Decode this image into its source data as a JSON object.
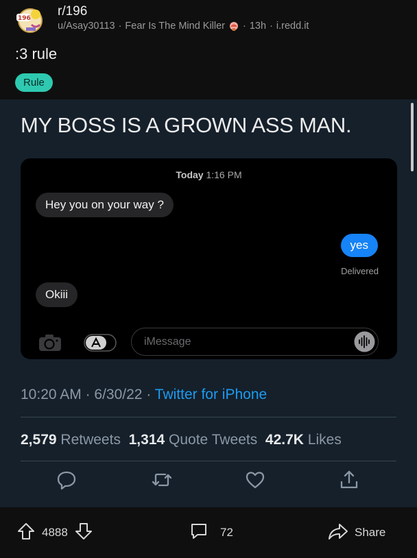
{
  "post": {
    "subreddit": "r/196",
    "username": "u/Asay30113",
    "flair": "Fear Is The Mind Killer",
    "age": "13h",
    "domain": "i.redd.it",
    "title": ":3 rule",
    "tag": "Rule"
  },
  "tweet": {
    "text": "MY BOSS IS A GROWN ASS MAN.",
    "imessage": {
      "timestamp_day": "Today",
      "timestamp_time": "1:16 PM",
      "messages": [
        {
          "from": "them",
          "text": "Hey you on your way ?"
        },
        {
          "from": "me",
          "text": "yes"
        },
        {
          "from": "them",
          "text": "Okiii"
        }
      ],
      "status": "Delivered",
      "input_placeholder": "iMessage"
    },
    "time": "10:20 AM",
    "date": "6/30/22",
    "source": "Twitter for iPhone",
    "retweets": "2,579",
    "retweets_label": "Retweets",
    "quotes": "1,314",
    "quotes_label": "Quote Tweets",
    "likes": "42.7K",
    "likes_label": "Likes"
  },
  "bottom_bar": {
    "votes": "4888",
    "comments": "72",
    "share_label": "Share"
  },
  "colors": {
    "rule_tag": "#2ec9b0",
    "tweet_bg": "#15202b",
    "imessage_blue": "#1683f6",
    "twitter_link": "#1d9bf0"
  }
}
